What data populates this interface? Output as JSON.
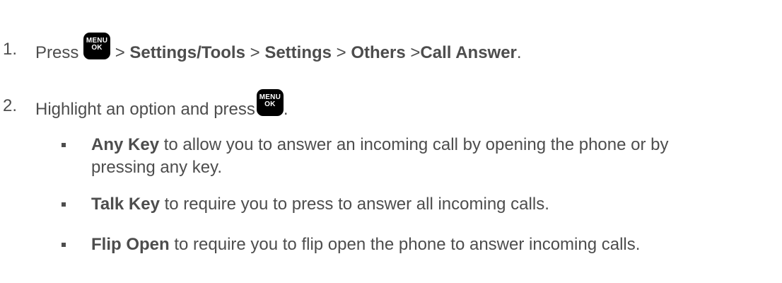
{
  "steps": [
    {
      "number": "1.",
      "parts": {
        "press": "Press",
        "sep1": ">",
        "path1": "Settings/Tools",
        "sep2": ">",
        "path2": "Settings",
        "sep3": ">",
        "path3": "Others",
        "sep4": ">",
        "path4": "Call Answer",
        "end": "."
      }
    },
    {
      "number": "2.",
      "parts": {
        "text": "Highlight an option and press",
        "end": "."
      }
    }
  ],
  "menu_key": {
    "line1": "MENU",
    "line2": "OK"
  },
  "options": [
    {
      "name": "Any Key",
      "desc_line1": "to allow you to answer an incoming call by opening the phone or by",
      "desc_line2": "pressing any key."
    },
    {
      "name": "Talk Key",
      "desc": "to require you to press to answer all incoming calls."
    },
    {
      "name": "Flip Open",
      "desc": "to require you to flip open the phone to answer incoming calls."
    }
  ]
}
